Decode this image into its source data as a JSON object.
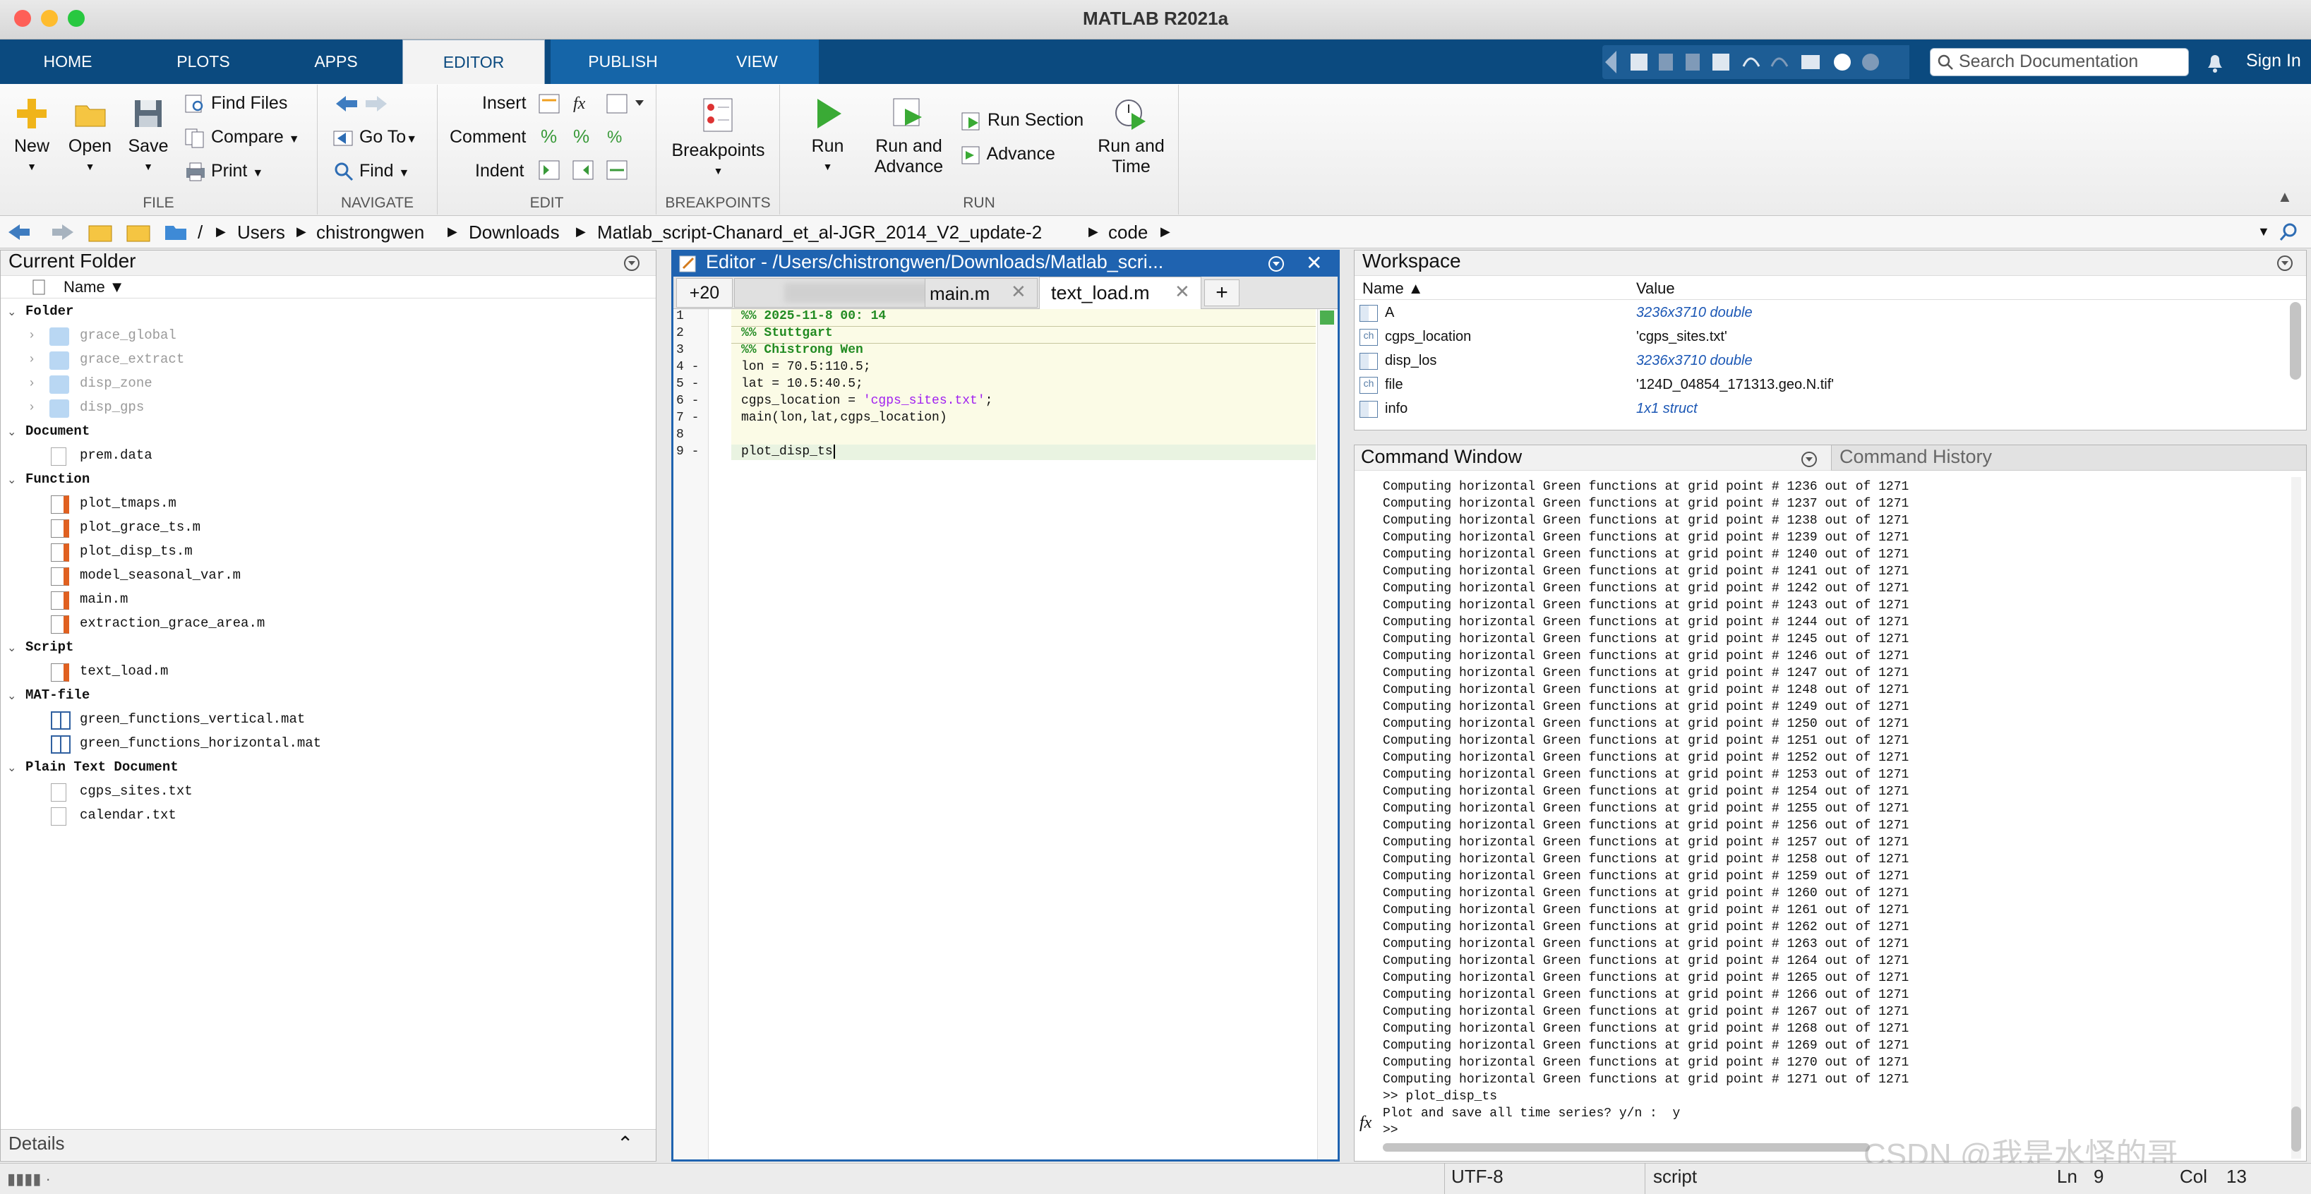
{
  "window": {
    "title": "MATLAB R2021a"
  },
  "ribbon": {
    "tabs": [
      "HOME",
      "PLOTS",
      "APPS",
      "EDITOR",
      "PUBLISH",
      "VIEW"
    ],
    "active_tab": "EDITOR",
    "search_placeholder": "Search Documentation",
    "sign_in": "Sign In"
  },
  "toolstrip": {
    "file": {
      "label": "FILE",
      "new": "New",
      "open": "Open",
      "save": "Save",
      "find_files": "Find Files",
      "compare": "Compare",
      "print": "Print"
    },
    "navigate": {
      "label": "NAVIGATE",
      "go_to": "Go To",
      "find": "Find"
    },
    "edit": {
      "label": "EDIT",
      "insert": "Insert",
      "comment": "Comment",
      "indent": "Indent",
      "fx": "fx"
    },
    "breakpoints": {
      "label": "BREAKPOINTS",
      "breakpoints": "Breakpoints"
    },
    "run": {
      "label": "RUN",
      "run": "Run",
      "run_and_advance_1": "Run and",
      "run_and_advance_2": "Advance",
      "run_section": "Run Section",
      "advance": "Advance",
      "run_and_time_1": "Run and",
      "run_and_time_2": "Time"
    }
  },
  "address": {
    "crumbs": [
      "/",
      "Users",
      "chistrongwen",
      "Downloads",
      "Matlab_script-Chanard_et_al-JGR_2014_V2_update-2",
      "code"
    ]
  },
  "current_folder": {
    "title": "Current Folder",
    "column": "Name ▼",
    "groups": [
      {
        "label": "Folder",
        "items": [
          "grace_global",
          "grace_extract",
          "disp_zone",
          "disp_gps"
        ]
      },
      {
        "label": "Document",
        "items": [
          "prem.data"
        ]
      },
      {
        "label": "Function",
        "items": [
          "plot_tmaps.m",
          "plot_grace_ts.m",
          "plot_disp_ts.m",
          "model_seasonal_var.m",
          "main.m",
          "extraction_grace_area.m"
        ]
      },
      {
        "label": "Script",
        "items": [
          "text_load.m"
        ]
      },
      {
        "label": "MAT-file",
        "items": [
          "green_functions_vertical.mat",
          "green_functions_horizontal.mat"
        ]
      },
      {
        "label": "Plain Text Document",
        "items": [
          "cgps_sites.txt",
          "calendar.txt"
        ]
      }
    ],
    "details": "Details"
  },
  "editor": {
    "title": "Editor - /Users/chistrongwen/Downloads/Matlab_scri...",
    "tabs": [
      "+20",
      "main.m",
      "text_load.m",
      "+"
    ],
    "active_tab": "text_load.m",
    "lines": [
      {
        "n": "1",
        "text": "%% 2025-11-8 00: 14"
      },
      {
        "n": "2",
        "text": "%% Stuttgart"
      },
      {
        "n": "3",
        "text": "%% Chistrong Wen"
      },
      {
        "n": "4 -",
        "text": "lon = 70.5:110.5;"
      },
      {
        "n": "5 -",
        "text": "lat = 10.5:40.5;"
      },
      {
        "n": "6 -",
        "text": "cgps_location = ",
        "str": "'cgps_sites.txt'",
        "end": ";"
      },
      {
        "n": "7 -",
        "text": "main(lon,lat,cgps_location)"
      },
      {
        "n": "8",
        "text": ""
      },
      {
        "n": "9 -",
        "text": "plot_disp_ts"
      }
    ]
  },
  "workspace": {
    "title": "Workspace",
    "columns": [
      "Name ▲",
      "Value"
    ],
    "rows": [
      {
        "name": "A",
        "value": "3236x3710 double",
        "style": "blue"
      },
      {
        "name": "cgps_location",
        "value": "'cgps_sites.txt'",
        "style": "plain"
      },
      {
        "name": "disp_los",
        "value": "3236x3710 double",
        "style": "blue"
      },
      {
        "name": "file",
        "value": "'124D_04854_171313.geo.N.tif'",
        "style": "plain"
      },
      {
        "name": "info",
        "value": "1x1 struct",
        "style": "blue"
      }
    ]
  },
  "command_window": {
    "title": "Command Window",
    "history_tab": "Command History",
    "first_point": 1236,
    "last_point": 1271,
    "line_template": "Computing horizontal Green functions at grid point # {n} out of 1271",
    "tail": [
      ">> plot_disp_ts",
      "Plot and save all time series? y/n :  y",
      ">>"
    ],
    "fx": "fx",
    "watermark": "CSDN @我是水怪的哥"
  },
  "status": {
    "encoding": "UTF-8",
    "type": "script",
    "ln_label": "Ln",
    "ln": "9",
    "col_label": "Col",
    "col": "13"
  },
  "colors": {
    "ribbon_blue": "#0b4a7f",
    "comment_green": "#228b22",
    "string_purple": "#a020f0",
    "cell_yellow": "#fbfbe6"
  }
}
